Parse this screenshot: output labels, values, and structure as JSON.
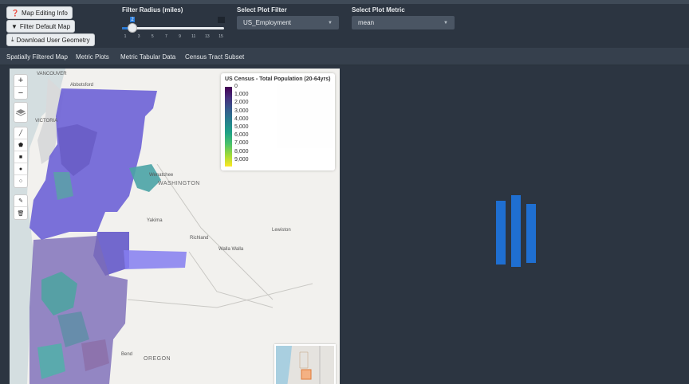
{
  "toolbar": {
    "map_editing_info": "Map Editing Info",
    "filter_default_map": "Filter Default Map",
    "download_user_geometry": "Download User Geometry"
  },
  "filter_radius": {
    "label": "Filter Radius (miles)",
    "value": "2",
    "ticks": [
      "1",
      "3",
      "5",
      "7",
      "9",
      "11",
      "13",
      "15"
    ]
  },
  "plot_filter": {
    "label": "Select Plot Filter",
    "selected": "US_Employment"
  },
  "plot_metric": {
    "label": "Select Plot Metric",
    "selected": "mean"
  },
  "tabs": [
    "Spatially Filtered Map",
    "Metric Plots",
    "Metric Tabular Data",
    "Census Tract Subset"
  ],
  "map": {
    "zoom_in": "+",
    "zoom_out": "−",
    "place_labels": {
      "vancouver": "VANCOUVER",
      "abbotsford": "Abbotsford",
      "victoria": "VICTORIA",
      "wenatchee": "Wenatchee",
      "washington": "WASHINGTON",
      "yakima": "Yakima",
      "richland": "Richland",
      "walla_walla": "Walla Walla",
      "lewiston": "Lewiston",
      "bend": "Bend",
      "oregon": "OREGON"
    },
    "legend": {
      "title": "US Census - Total Population (20-64yrs)",
      "labels": [
        "0",
        "1,000",
        "2,000",
        "3,000",
        "4,000",
        "5,000",
        "6,000",
        "7,000",
        "8,000",
        "9,000"
      ]
    }
  },
  "colors": {
    "accent": "#2a7ad6",
    "background": "#2c3541",
    "spinner": "#1f6fd1"
  }
}
